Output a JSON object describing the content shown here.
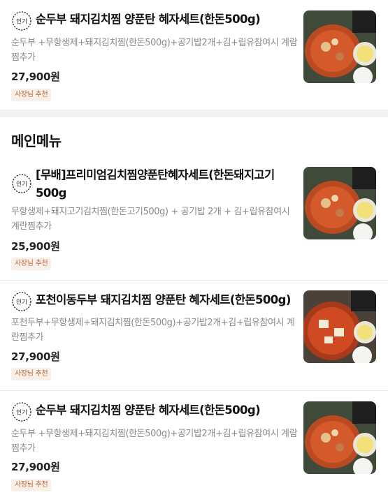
{
  "section": {
    "title": "메인메뉴"
  },
  "badge_label": "인기",
  "items": [
    {
      "title": "순두부 돼지김치찜 양푼탄 혜자세트(한돈500g)",
      "desc": "순두부 +무항생제+돼지김치찜(한돈500g)+공기밥2개+김+립유참여시 계람찜추가",
      "price": "27,900원",
      "tag": "사장님 추천",
      "thumb_icon": "kimchi-jjim-set-photo"
    },
    {
      "title": "[무배]프리미엄김치찜양푼탄혜자세트(한돈돼지고기500g",
      "desc": "무항생제+돼지고기김치찜(한돈고기500g) +   공기밥 2개 + 김+립유참여시 계란찜추가",
      "price": "25,900원",
      "tag": "사장님 추천",
      "thumb_icon": "kimchi-jjim-set-photo"
    },
    {
      "title": "포천이동두부 돼지김치찜 양푼탄 혜자세트(한돈500g)",
      "desc": "포천두부+무항생제+돼지김치찜(한돈500g)+공기밥2개+김+립유참여시 계란찜추가",
      "price": "27,900원",
      "tag": "사장님 추천",
      "thumb_icon": "kimchi-jjim-tofu-photo"
    },
    {
      "title": "순두부 돼지김치찜 양푼탄 혜자세트(한돈500g)",
      "desc": "순두부 +무항생제+돼지김치찜(한돈500g)+공기밥2개+김+립유참여시 계람찜추가",
      "price": "27,900원",
      "tag": "사장님 추천",
      "thumb_icon": "kimchi-jjim-set-photo"
    }
  ]
}
